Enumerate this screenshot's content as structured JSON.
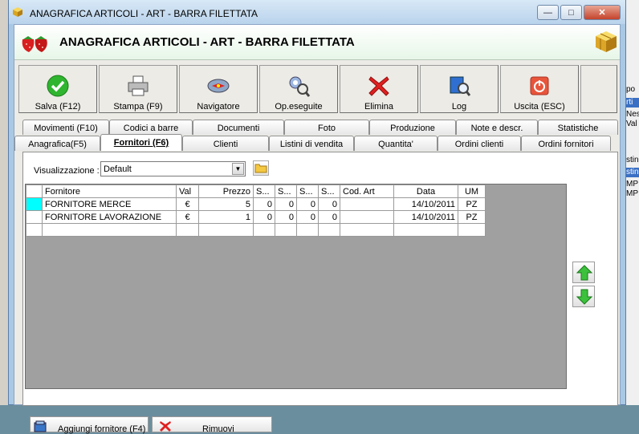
{
  "window": {
    "title": "ANAGRAFICA ARTICOLI - ART - BARRA FILETTATA",
    "controls": {
      "minimize": "—",
      "maximize": "□",
      "close": "✕"
    }
  },
  "header": {
    "title": "ANAGRAFICA ARTICOLI - ART - BARRA FILETTATA"
  },
  "toolbar": {
    "save": "Salva (F12)",
    "print": "Stampa (F9)",
    "navigator": "Navigatore",
    "operations": "Op.eseguite",
    "delete": "Elimina",
    "log": "Log",
    "exit": "Uscita (ESC)"
  },
  "tabs_top": [
    "Movimenti (F10)",
    "Codici a barre",
    "Documenti",
    "Foto",
    "Produzione",
    "Note e descr.",
    "Statistiche"
  ],
  "tabs_bottom": [
    "Anagrafica(F5)",
    "Fornitori (F6)",
    "Clienti",
    "Listini di vendita",
    "Quantita'",
    "Ordini clienti",
    "Ordini fornitori"
  ],
  "active_tab": "Fornitori (F6)",
  "view": {
    "label": "Visualizzazione :",
    "selected": "Default",
    "dropdown_arrow": "▼"
  },
  "grid": {
    "columns": [
      "Fornitore",
      "Val",
      "Prezzo",
      "S...",
      "S...",
      "S...",
      "S...",
      "Cod. Art",
      "Data",
      "UM"
    ],
    "rows": [
      [
        "FORNITORE MERCE",
        "€",
        "5",
        "0",
        "0",
        "0",
        "0",
        "",
        "14/10/2011",
        "PZ"
      ],
      [
        "FORNITORE LAVORAZIONE",
        "€",
        "1",
        "0",
        "0",
        "0",
        "0",
        "",
        "14/10/2011",
        "PZ"
      ]
    ]
  },
  "buttons": {
    "add_supplier": "Aggiungi fornitore (F4)",
    "remove": "Rimuovi"
  },
  "background_window": {
    "labels": [
      "po",
      "rti",
      "Nes",
      "Val",
      "stin",
      "stin",
      "MP",
      "MP"
    ]
  }
}
